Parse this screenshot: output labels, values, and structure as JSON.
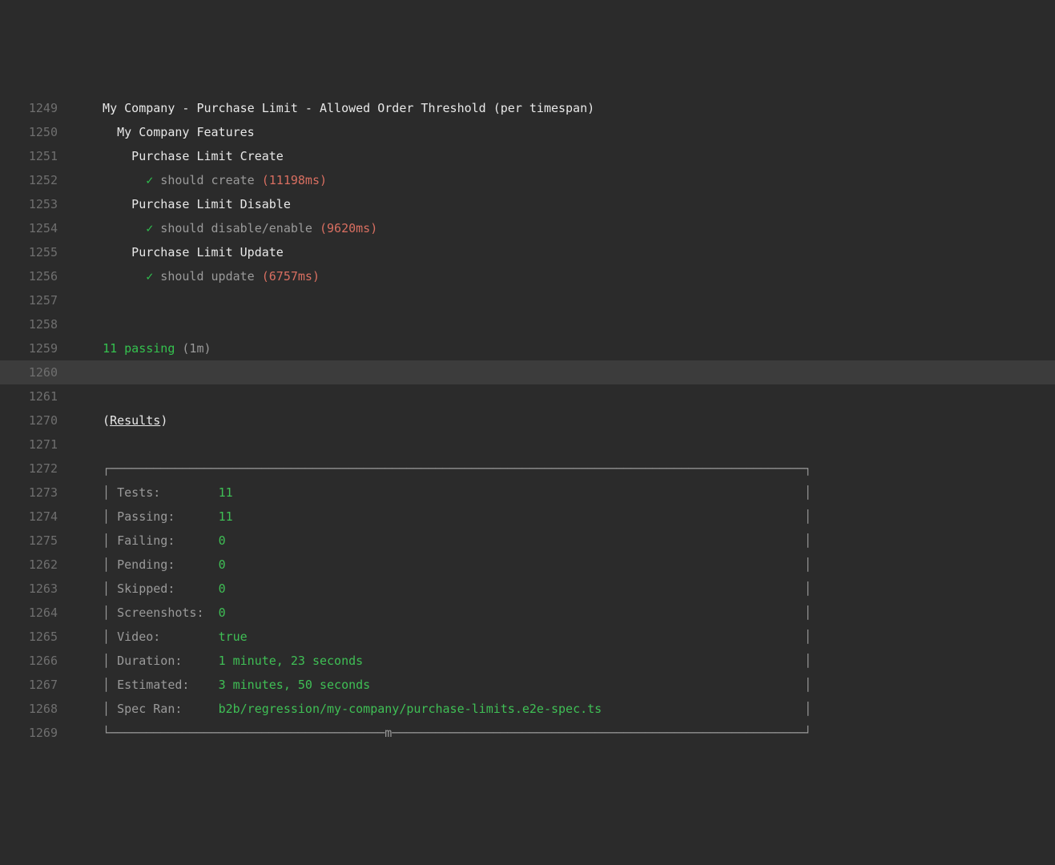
{
  "lines": [
    {
      "no": "1249",
      "hl": false,
      "segs": [
        {
          "cls": "white",
          "t": "  My Company - Purchase Limit - Allowed Order Threshold (per timespan)"
        }
      ]
    },
    {
      "no": "1250",
      "hl": false,
      "segs": [
        {
          "cls": "white",
          "t": "    My Company Features"
        }
      ]
    },
    {
      "no": "1251",
      "hl": false,
      "segs": [
        {
          "cls": "white",
          "t": "      Purchase Limit Create"
        }
      ]
    },
    {
      "no": "1252",
      "hl": false,
      "segs": [
        {
          "cls": "",
          "t": "        "
        },
        {
          "cls": "green-check",
          "t": "✓"
        },
        {
          "cls": "grey",
          "t": " should create "
        },
        {
          "cls": "red",
          "t": "(11198ms)"
        }
      ]
    },
    {
      "no": "1253",
      "hl": false,
      "segs": [
        {
          "cls": "white",
          "t": "      Purchase Limit Disable"
        }
      ]
    },
    {
      "no": "1254",
      "hl": false,
      "segs": [
        {
          "cls": "",
          "t": "        "
        },
        {
          "cls": "green-check",
          "t": "✓"
        },
        {
          "cls": "grey",
          "t": " should disable/enable "
        },
        {
          "cls": "red",
          "t": "(9620ms)"
        }
      ]
    },
    {
      "no": "1255",
      "hl": false,
      "segs": [
        {
          "cls": "white",
          "t": "      Purchase Limit Update"
        }
      ]
    },
    {
      "no": "1256",
      "hl": false,
      "segs": [
        {
          "cls": "",
          "t": "        "
        },
        {
          "cls": "green-check",
          "t": "✓"
        },
        {
          "cls": "grey",
          "t": " should update "
        },
        {
          "cls": "red",
          "t": "(6757ms)"
        }
      ]
    },
    {
      "no": "1257",
      "hl": false,
      "segs": [
        {
          "cls": "",
          "t": ""
        }
      ]
    },
    {
      "no": "1258",
      "hl": false,
      "segs": [
        {
          "cls": "",
          "t": ""
        }
      ]
    },
    {
      "no": "1259",
      "hl": false,
      "segs": [
        {
          "cls": "",
          "t": "  "
        },
        {
          "cls": "green-bright",
          "t": "11 passing"
        },
        {
          "cls": "grey",
          "t": " (1m)"
        }
      ]
    },
    {
      "no": "1260",
      "hl": true,
      "segs": [
        {
          "cls": "",
          "t": ""
        }
      ]
    },
    {
      "no": "1261",
      "hl": false,
      "segs": [
        {
          "cls": "",
          "t": ""
        }
      ]
    },
    {
      "no": "1270",
      "hl": false,
      "segs": [
        {
          "cls": "white",
          "t": "  ("
        },
        {
          "cls": "white underline",
          "t": "Results"
        },
        {
          "cls": "white",
          "t": ")"
        }
      ]
    },
    {
      "no": "1271",
      "hl": false,
      "segs": [
        {
          "cls": "",
          "t": ""
        }
      ]
    },
    {
      "no": "1272",
      "hl": false,
      "segs": [
        {
          "cls": "grey",
          "t": "  ┌────────────────────────────────────────────────────────────────────────────────────────────────┐"
        }
      ]
    },
    {
      "no": "1273",
      "hl": false,
      "segs": [
        {
          "cls": "grey",
          "t": "  │ Tests:        "
        },
        {
          "cls": "green-val",
          "t": "11"
        },
        {
          "cls": "grey",
          "t": "                                                                               │"
        }
      ]
    },
    {
      "no": "1274",
      "hl": false,
      "segs": [
        {
          "cls": "grey",
          "t": "  │ Passing:      "
        },
        {
          "cls": "green-val",
          "t": "11"
        },
        {
          "cls": "grey",
          "t": "                                                                               │"
        }
      ]
    },
    {
      "no": "1275",
      "hl": false,
      "segs": [
        {
          "cls": "grey",
          "t": "  │ Failing:      "
        },
        {
          "cls": "green-val",
          "t": "0"
        },
        {
          "cls": "grey",
          "t": "                                                                                │"
        }
      ]
    },
    {
      "no": "1262",
      "hl": false,
      "segs": [
        {
          "cls": "grey",
          "t": "  │ Pending:      "
        },
        {
          "cls": "green-val",
          "t": "0"
        },
        {
          "cls": "grey",
          "t": "                                                                                │"
        }
      ]
    },
    {
      "no": "1263",
      "hl": false,
      "segs": [
        {
          "cls": "grey",
          "t": "  │ Skipped:      "
        },
        {
          "cls": "green-val",
          "t": "0"
        },
        {
          "cls": "grey",
          "t": "                                                                                │"
        }
      ]
    },
    {
      "no": "1264",
      "hl": false,
      "segs": [
        {
          "cls": "grey",
          "t": "  │ Screenshots:  "
        },
        {
          "cls": "green-val",
          "t": "0"
        },
        {
          "cls": "grey",
          "t": "                                                                                │"
        }
      ]
    },
    {
      "no": "1265",
      "hl": false,
      "segs": [
        {
          "cls": "grey",
          "t": "  │ Video:        "
        },
        {
          "cls": "green-val",
          "t": "true"
        },
        {
          "cls": "grey",
          "t": "                                                                             │"
        }
      ]
    },
    {
      "no": "1266",
      "hl": false,
      "segs": [
        {
          "cls": "grey",
          "t": "  │ Duration:     "
        },
        {
          "cls": "green-val",
          "t": "1 minute, 23 seconds"
        },
        {
          "cls": "grey",
          "t": "                                                             │"
        }
      ]
    },
    {
      "no": "1267",
      "hl": false,
      "segs": [
        {
          "cls": "grey",
          "t": "  │ Estimated:    "
        },
        {
          "cls": "green-val",
          "t": "3 minutes, 50 seconds"
        },
        {
          "cls": "grey",
          "t": "                                                            │"
        }
      ]
    },
    {
      "no": "1268",
      "hl": false,
      "segs": [
        {
          "cls": "grey",
          "t": "  │ Spec Ran:     "
        },
        {
          "cls": "green-val",
          "t": "b2b/regression/my-company/purchase-limits.e2e-spec.ts"
        },
        {
          "cls": "grey",
          "t": "                            │"
        }
      ]
    },
    {
      "no": "1269",
      "hl": false,
      "segs": [
        {
          "cls": "grey",
          "t": "  └──────────────────────────────────────m─────────────────────────────────────────────────────────┘"
        }
      ]
    }
  ],
  "results_table": {
    "Tests": "11",
    "Passing": "11",
    "Failing": "0",
    "Pending": "0",
    "Skipped": "0",
    "Screenshots": "0",
    "Video": "true",
    "Duration": "1 minute, 23 seconds",
    "Estimated": "3 minutes, 50 seconds",
    "Spec Ran": "b2b/regression/my-company/purchase-limits.e2e-spec.ts"
  },
  "summary": {
    "passing_count": "11",
    "passing_label": "passing",
    "elapsed": "(1m)"
  }
}
